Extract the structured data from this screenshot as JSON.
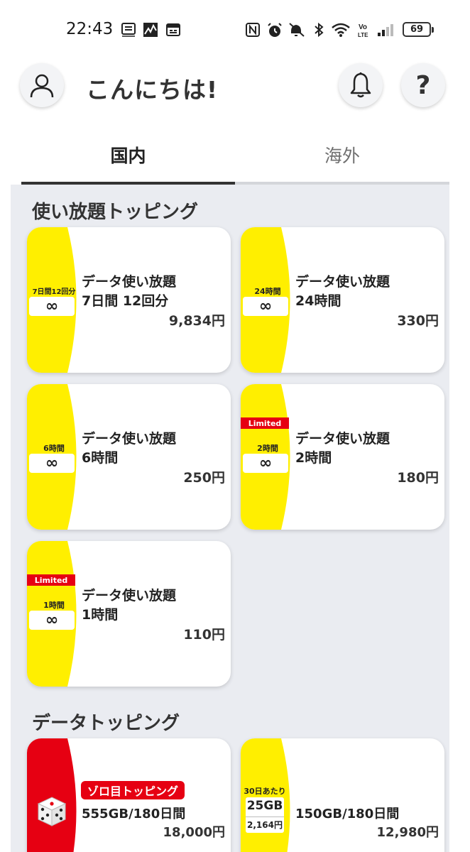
{
  "status_bar": {
    "time": "22:43",
    "battery": "69",
    "left_icons": [
      "dmenu-news-icon",
      "stock-chart-icon",
      "calendar-icon"
    ],
    "right_icons": [
      "nfc-icon",
      "alarm-icon",
      "mute-icon",
      "bluetooth-icon",
      "wifi-icon",
      "volte-icon",
      "signal-icon"
    ]
  },
  "header": {
    "greeting": "こんにちは!",
    "help_label": "?"
  },
  "tabs": [
    {
      "label": "国内",
      "active": true
    },
    {
      "label": "海外",
      "active": false
    }
  ],
  "sections": [
    {
      "title": "使い放題トッピング",
      "cards": [
        {
          "badge_duration": "7日間12回分",
          "badge_symbol": "∞",
          "limited": "",
          "title_line1": "データ使い放題",
          "title_line2": "7日間 12回分",
          "price": "9,834円"
        },
        {
          "badge_duration": "24時間",
          "badge_symbol": "∞",
          "limited": "",
          "title_line1": "データ使い放題",
          "title_line2": "24時間",
          "price": "330円"
        },
        {
          "badge_duration": "6時間",
          "badge_symbol": "∞",
          "limited": "",
          "title_line1": "データ使い放題",
          "title_line2": "6時間",
          "price": "250円"
        },
        {
          "badge_duration": "2時間",
          "badge_symbol": "∞",
          "limited": "Limited",
          "title_line1": "データ使い放題",
          "title_line2": "2時間",
          "price": "180円"
        },
        {
          "badge_duration": "1時間",
          "badge_symbol": "∞",
          "limited": "Limited",
          "title_line1": "データ使い放題",
          "title_line2": "1時間",
          "price": "110円"
        }
      ]
    },
    {
      "title": "データトッピング",
      "cards": [
        {
          "badge": "ゾロ目トッピング",
          "title": "555GB/180日間",
          "price": "18,000円",
          "icon": "dice-icon"
        },
        {
          "gb_top": "30日あたり",
          "gb_amount": "25GB",
          "gb_price": "2,164円",
          "title": "150GB/180日間",
          "price": "12,980円"
        }
      ]
    }
  ],
  "colors": {
    "accent_yellow": "#ffef00",
    "accent_red": "#e60012",
    "content_background": "#eaecf1",
    "text_dark": "#222222"
  }
}
